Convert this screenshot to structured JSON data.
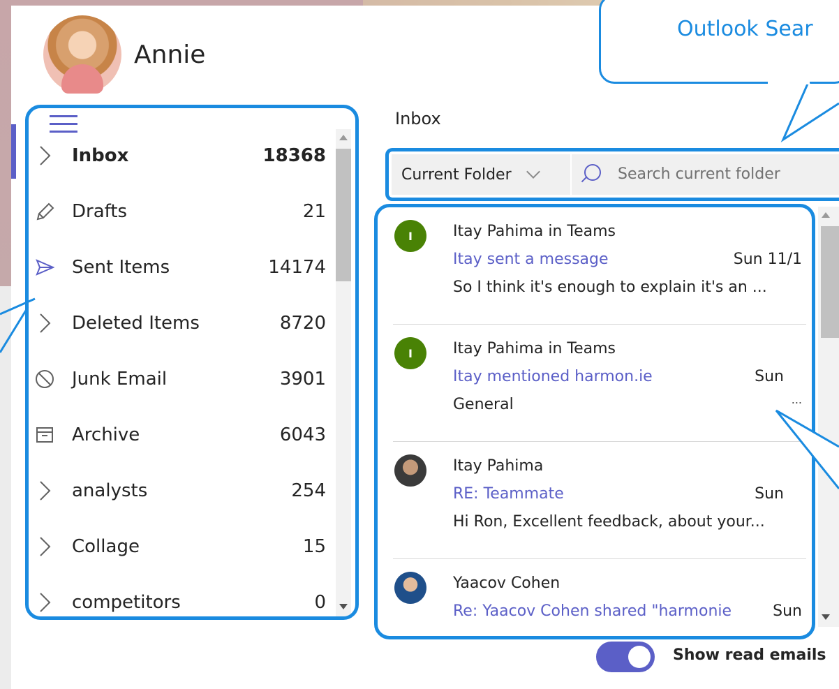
{
  "user": {
    "name": "Annie"
  },
  "folders": [
    {
      "name": "Inbox",
      "count": "18368",
      "icon": "chevron-right-icon",
      "bold": true
    },
    {
      "name": "Drafts",
      "count": "21",
      "icon": "pencil-icon"
    },
    {
      "name": "Sent Items",
      "count": "14174",
      "icon": "send-icon"
    },
    {
      "name": "Deleted Items",
      "count": "8720",
      "icon": "chevron-right-icon"
    },
    {
      "name": "Junk Email",
      "count": "3901",
      "icon": "block-icon"
    },
    {
      "name": "Archive",
      "count": "6043",
      "icon": "archive-icon"
    },
    {
      "name": "analysts",
      "count": "254",
      "icon": "chevron-right-icon"
    },
    {
      "name": "Collage",
      "count": "15",
      "icon": "chevron-right-icon"
    },
    {
      "name": "competitors",
      "count": "0",
      "icon": "chevron-right-icon"
    }
  ],
  "inbox": {
    "title": "Inbox",
    "scope": "Current Folder",
    "search_placeholder": "Search current folder"
  },
  "messages": [
    {
      "initial": "I",
      "sender": "Itay Pahima in Teams",
      "subject": "Itay sent a message",
      "date": "Sun 11/1",
      "preview": "So I think it's enough to explain it's an ...",
      "more": ""
    },
    {
      "initial": "I",
      "sender": "Itay Pahima in Teams",
      "subject": "Itay mentioned harmon.ie",
      "date": "Sun",
      "preview": "General",
      "more": "..."
    },
    {
      "initial": "",
      "sender": "Itay Pahima",
      "subject": "RE: Teammate",
      "date": "Sun",
      "preview": "Hi Ron,  Excellent feedback, about your...",
      "more": ""
    },
    {
      "initial": "",
      "sender": "Yaacov Cohen",
      "subject": "Re: Yaacov Cohen shared \"harmonie",
      "date": "Sun",
      "preview": "",
      "more": ""
    }
  ],
  "callout": {
    "text": "Outlook Sear"
  },
  "toggle": {
    "label": "Show read emails",
    "on": true
  },
  "colors": {
    "accent": "#5b5fc7",
    "highlight": "#1a8be0",
    "teams_green": "#498205"
  }
}
